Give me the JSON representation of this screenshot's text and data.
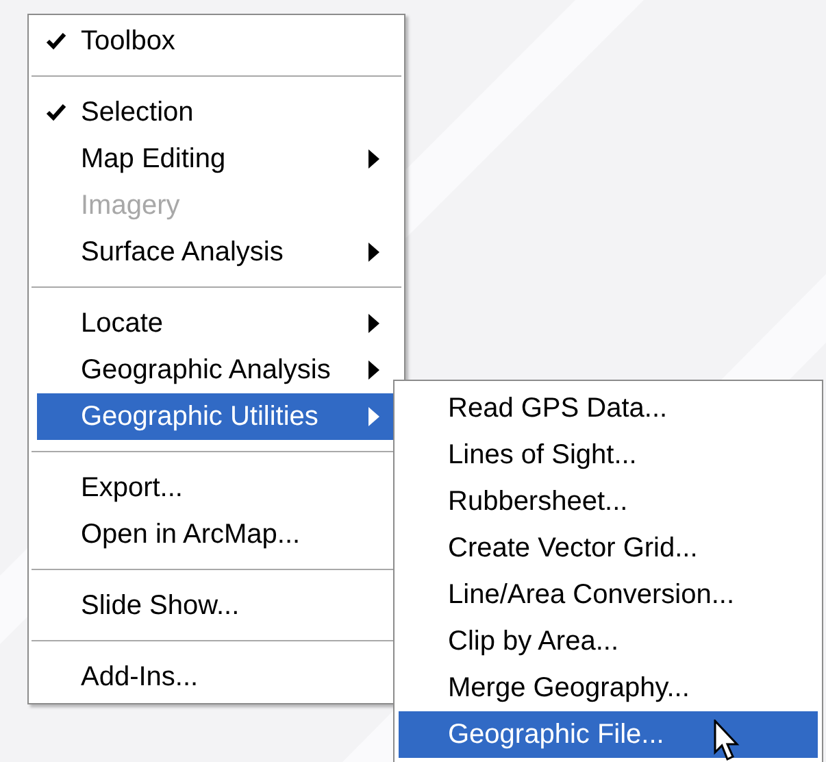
{
  "menu": {
    "items": [
      {
        "kind": "item",
        "label": "Toolbox",
        "checked": true,
        "disabled": false,
        "has_submenu": false,
        "selected": false
      },
      {
        "kind": "separator"
      },
      {
        "kind": "item",
        "label": "Selection",
        "checked": true,
        "disabled": false,
        "has_submenu": false,
        "selected": false
      },
      {
        "kind": "item",
        "label": "Map Editing",
        "checked": false,
        "disabled": false,
        "has_submenu": true,
        "selected": false
      },
      {
        "kind": "item",
        "label": "Imagery",
        "checked": false,
        "disabled": true,
        "has_submenu": false,
        "selected": false
      },
      {
        "kind": "item",
        "label": "Surface Analysis",
        "checked": false,
        "disabled": false,
        "has_submenu": true,
        "selected": false
      },
      {
        "kind": "separator"
      },
      {
        "kind": "item",
        "label": "Locate",
        "checked": false,
        "disabled": false,
        "has_submenu": true,
        "selected": false
      },
      {
        "kind": "item",
        "label": "Geographic Analysis",
        "checked": false,
        "disabled": false,
        "has_submenu": true,
        "selected": false
      },
      {
        "kind": "item",
        "label": "Geographic Utilities",
        "checked": false,
        "disabled": false,
        "has_submenu": true,
        "selected": true
      },
      {
        "kind": "separator"
      },
      {
        "kind": "item",
        "label": "Export...",
        "checked": false,
        "disabled": false,
        "has_submenu": false,
        "selected": false
      },
      {
        "kind": "item",
        "label": "Open in ArcMap...",
        "checked": false,
        "disabled": false,
        "has_submenu": false,
        "selected": false
      },
      {
        "kind": "separator"
      },
      {
        "kind": "item",
        "label": "Slide Show...",
        "checked": false,
        "disabled": false,
        "has_submenu": false,
        "selected": false
      },
      {
        "kind": "separator"
      },
      {
        "kind": "item",
        "label": "Add-Ins...",
        "checked": false,
        "disabled": false,
        "has_submenu": false,
        "selected": false
      }
    ]
  },
  "submenu": {
    "items": [
      {
        "label": "Read GPS Data...",
        "selected": false
      },
      {
        "label": "Lines of Sight...",
        "selected": false
      },
      {
        "label": "Rubbersheet...",
        "selected": false
      },
      {
        "label": "Create Vector Grid...",
        "selected": false
      },
      {
        "label": "Line/Area Conversion...",
        "selected": false
      },
      {
        "label": "Clip by Area...",
        "selected": false
      },
      {
        "label": "Merge Geography...",
        "selected": false
      },
      {
        "label": "Geographic File...",
        "selected": true
      }
    ]
  }
}
